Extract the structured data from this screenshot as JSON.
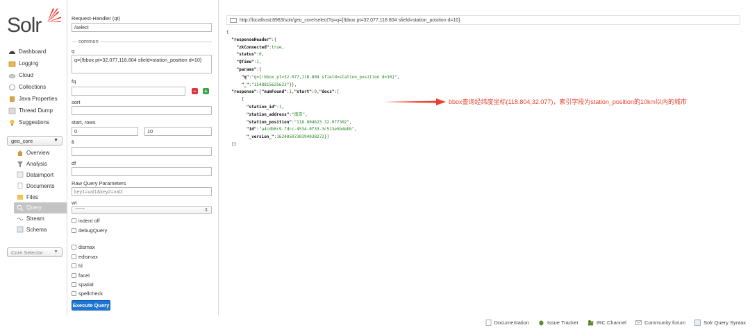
{
  "logo": {
    "text": "Solr"
  },
  "nav": [
    {
      "label": "Dashboard",
      "icon": "dashboard-icon"
    },
    {
      "label": "Logging",
      "icon": "logging-icon"
    },
    {
      "label": "Cloud",
      "icon": "cloud-icon"
    },
    {
      "label": "Collections",
      "icon": "collections-icon"
    },
    {
      "label": "Java Properties",
      "icon": "java-properties-icon"
    },
    {
      "label": "Thread Dump",
      "icon": "thread-dump-icon"
    },
    {
      "label": "Suggestions",
      "icon": "suggestions-icon"
    }
  ],
  "core_select": {
    "value": "geo_core"
  },
  "core_nav": [
    {
      "label": "Overview",
      "icon": "overview-icon"
    },
    {
      "label": "Analysis",
      "icon": "analysis-icon"
    },
    {
      "label": "Dataimport",
      "icon": "dataimport-icon"
    },
    {
      "label": "Documents",
      "icon": "documents-icon"
    },
    {
      "label": "Files",
      "icon": "files-icon"
    },
    {
      "label": "Query",
      "icon": "query-icon"
    },
    {
      "label": "Stream",
      "icon": "stream-icon"
    },
    {
      "label": "Schema",
      "icon": "schema-icon"
    }
  ],
  "core_selector": {
    "placeholder": "Core Selector"
  },
  "form": {
    "request_handler_label": "Request-Handler (qt)",
    "request_handler_value": "/select",
    "common_label": "common",
    "q_label": "q",
    "q_value": "q={!bbox pt=32.077,118.804 sfield=station_position d=10}",
    "fq_label": "fq",
    "sort_label": "sort",
    "start_rows_label": "start, rows",
    "start_value": "0",
    "rows_value": "10",
    "fl_label": "fl",
    "df_label": "df",
    "raw_label": "Raw Query Parameters",
    "raw_placeholder": "key1=val1&key2=val2",
    "wt_label": "wt",
    "wt_value": "------",
    "indent_label": "indent off",
    "debug_label": "debugQuery",
    "dismax_label": "dismax",
    "edismax_label": "edismax",
    "hl_label": "hl",
    "facet_label": "facet",
    "spatial_label": "spatial",
    "spellcheck_label": "spellcheck",
    "execute_label": "Execute Query"
  },
  "result": {
    "url": "http://localhost:8983/solr/geo_core/select?q=q={!bbox pt=32.077,118.804 sfield=station_position d=10}",
    "json": {
      "zkConnected": "true",
      "status": "0",
      "QTime": "1",
      "q_param": "\"q={!bbox pt=32.077,118.804 sfield=station_position d=10}\"",
      "underscore_param": "\"1548815625622\"",
      "numFound": "1",
      "start": "0",
      "station_id": "1",
      "station_address": "\"南京\"",
      "station_position": "\"118.804623 32.077302\"",
      "id": "\"a4cdb0c9-fdcc-4534-9f33-3c513e5bdebb\"",
      "version": "1624050730394038272"
    },
    "annotation": "bbox查询经纬度坐标(118.804,32.077)，索引字段为station_position的10km以内的城市",
    "accent_color": "#e8412f"
  },
  "footer": [
    {
      "label": "Documentation",
      "icon": "documentation-icon"
    },
    {
      "label": "Issue Tracker",
      "icon": "issue-tracker-icon"
    },
    {
      "label": "IRC Channel",
      "icon": "irc-channel-icon"
    },
    {
      "label": "Community forum",
      "icon": "community-forum-icon"
    },
    {
      "label": "Solr Query Syntax",
      "icon": "solr-query-syntax-icon"
    }
  ]
}
